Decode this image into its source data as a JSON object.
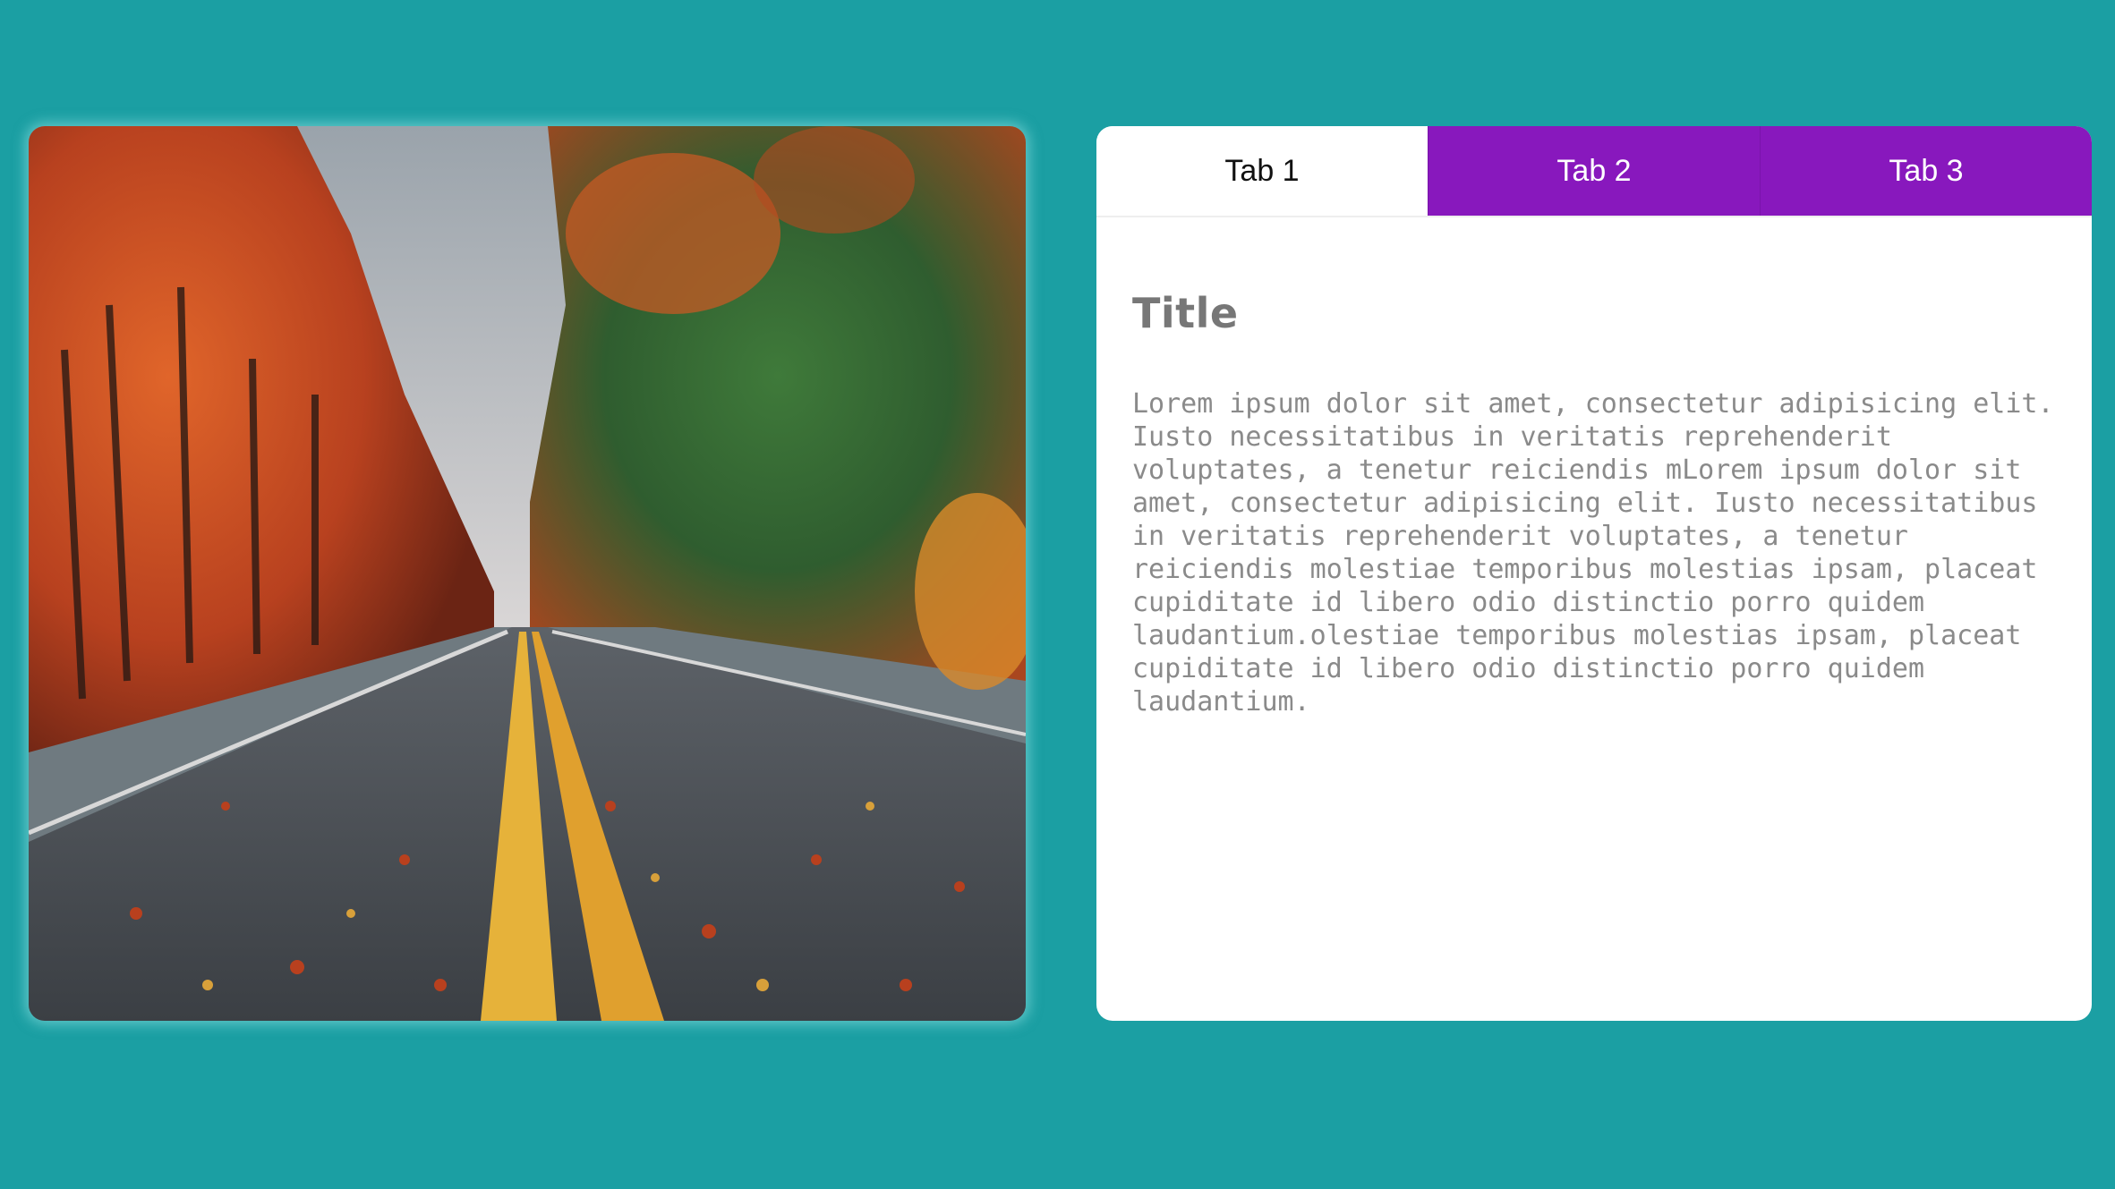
{
  "photo": {
    "subject": "autumn road with trees"
  },
  "tabs": [
    {
      "label": "Tab 1",
      "active": true
    },
    {
      "label": "Tab 2",
      "active": false
    },
    {
      "label": "Tab 3",
      "active": false
    }
  ],
  "content": {
    "title": "Title",
    "body": "Lorem ipsum dolor sit amet, consectetur adipisicing elit. Iusto necessitatibus in veritatis reprehenderit voluptates, a tenetur reiciendis mLorem ipsum dolor sit amet, consectetur adipisicing elit. Iusto necessitatibus in veritatis reprehenderit voluptates, a tenetur reiciendis molestiae temporibus molestias ipsam, placeat cupiditate id libero odio distinctio porro quidem laudantium.olestiae temporibus molestias ipsam, placeat cupiditate id libero odio distinctio porro quidem laudantium."
  },
  "colors": {
    "background": "#1b9fa3",
    "tab_active_bg": "#ffffff",
    "tab_inactive_bg": "#8818bd",
    "title_text": "#777777",
    "body_text": "#8a8a8a"
  }
}
